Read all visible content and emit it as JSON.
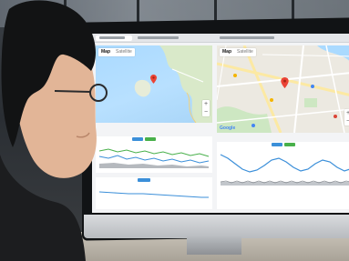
{
  "scene": {
    "description_colors": {
      "map_water": "#aadaff",
      "map_land": "#e8e6df",
      "pin_red": "#ea4335",
      "series_blue": "#3b8fd9",
      "series_green": "#48b04a",
      "series_gray": "#8a8f95"
    }
  },
  "left_map": {
    "toggle_map": "Map",
    "toggle_satellite": "Satellite",
    "zoom_plus": "+",
    "zoom_minus": "−"
  },
  "right_map": {
    "toggle_map": "Map",
    "toggle_satellite": "Satellite",
    "zoom_plus": "+",
    "zoom_minus": "−",
    "google_logo": "Google"
  }
}
